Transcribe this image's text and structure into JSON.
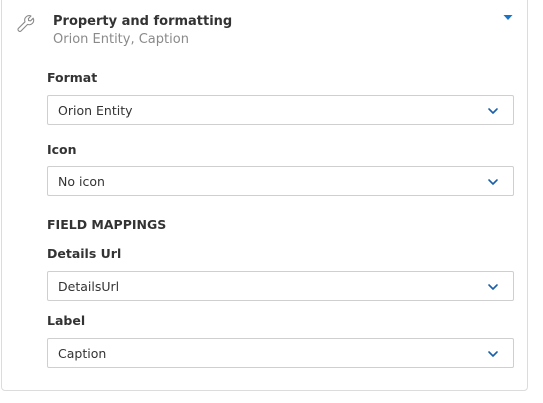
{
  "header": {
    "icon": "wrench-icon",
    "title": "Property and formatting",
    "subtitle": "Orion Entity, Caption",
    "toggle_icon": "caret-down-icon",
    "accent_color": "#1a73c9"
  },
  "fields": {
    "format": {
      "label": "Format",
      "value": "Orion Entity"
    },
    "icon": {
      "label": "Icon",
      "value": "No icon"
    }
  },
  "field_mappings": {
    "heading": "FIELD MAPPINGS",
    "details_url": {
      "label": "Details Url",
      "value": "DetailsUrl"
    },
    "label": {
      "label": "Label",
      "value": "Caption"
    }
  }
}
